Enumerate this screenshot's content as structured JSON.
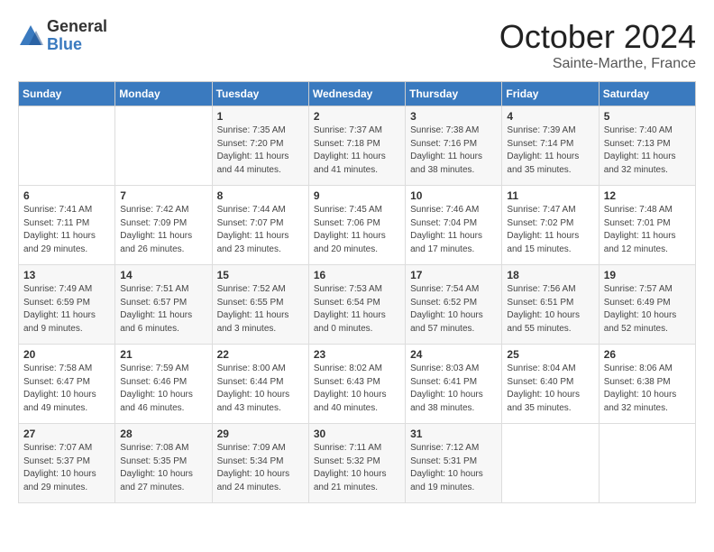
{
  "header": {
    "logo_general": "General",
    "logo_blue": "Blue",
    "month": "October 2024",
    "location": "Sainte-Marthe, France"
  },
  "weekdays": [
    "Sunday",
    "Monday",
    "Tuesday",
    "Wednesday",
    "Thursday",
    "Friday",
    "Saturday"
  ],
  "weeks": [
    [
      {
        "day": "",
        "info": ""
      },
      {
        "day": "",
        "info": ""
      },
      {
        "day": "1",
        "info": "Sunrise: 7:35 AM\nSunset: 7:20 PM\nDaylight: 11 hours\nand 44 minutes."
      },
      {
        "day": "2",
        "info": "Sunrise: 7:37 AM\nSunset: 7:18 PM\nDaylight: 11 hours\nand 41 minutes."
      },
      {
        "day": "3",
        "info": "Sunrise: 7:38 AM\nSunset: 7:16 PM\nDaylight: 11 hours\nand 38 minutes."
      },
      {
        "day": "4",
        "info": "Sunrise: 7:39 AM\nSunset: 7:14 PM\nDaylight: 11 hours\nand 35 minutes."
      },
      {
        "day": "5",
        "info": "Sunrise: 7:40 AM\nSunset: 7:13 PM\nDaylight: 11 hours\nand 32 minutes."
      }
    ],
    [
      {
        "day": "6",
        "info": "Sunrise: 7:41 AM\nSunset: 7:11 PM\nDaylight: 11 hours\nand 29 minutes."
      },
      {
        "day": "7",
        "info": "Sunrise: 7:42 AM\nSunset: 7:09 PM\nDaylight: 11 hours\nand 26 minutes."
      },
      {
        "day": "8",
        "info": "Sunrise: 7:44 AM\nSunset: 7:07 PM\nDaylight: 11 hours\nand 23 minutes."
      },
      {
        "day": "9",
        "info": "Sunrise: 7:45 AM\nSunset: 7:06 PM\nDaylight: 11 hours\nand 20 minutes."
      },
      {
        "day": "10",
        "info": "Sunrise: 7:46 AM\nSunset: 7:04 PM\nDaylight: 11 hours\nand 17 minutes."
      },
      {
        "day": "11",
        "info": "Sunrise: 7:47 AM\nSunset: 7:02 PM\nDaylight: 11 hours\nand 15 minutes."
      },
      {
        "day": "12",
        "info": "Sunrise: 7:48 AM\nSunset: 7:01 PM\nDaylight: 11 hours\nand 12 minutes."
      }
    ],
    [
      {
        "day": "13",
        "info": "Sunrise: 7:49 AM\nSunset: 6:59 PM\nDaylight: 11 hours\nand 9 minutes."
      },
      {
        "day": "14",
        "info": "Sunrise: 7:51 AM\nSunset: 6:57 PM\nDaylight: 11 hours\nand 6 minutes."
      },
      {
        "day": "15",
        "info": "Sunrise: 7:52 AM\nSunset: 6:55 PM\nDaylight: 11 hours\nand 3 minutes."
      },
      {
        "day": "16",
        "info": "Sunrise: 7:53 AM\nSunset: 6:54 PM\nDaylight: 11 hours\nand 0 minutes."
      },
      {
        "day": "17",
        "info": "Sunrise: 7:54 AM\nSunset: 6:52 PM\nDaylight: 10 hours\nand 57 minutes."
      },
      {
        "day": "18",
        "info": "Sunrise: 7:56 AM\nSunset: 6:51 PM\nDaylight: 10 hours\nand 55 minutes."
      },
      {
        "day": "19",
        "info": "Sunrise: 7:57 AM\nSunset: 6:49 PM\nDaylight: 10 hours\nand 52 minutes."
      }
    ],
    [
      {
        "day": "20",
        "info": "Sunrise: 7:58 AM\nSunset: 6:47 PM\nDaylight: 10 hours\nand 49 minutes."
      },
      {
        "day": "21",
        "info": "Sunrise: 7:59 AM\nSunset: 6:46 PM\nDaylight: 10 hours\nand 46 minutes."
      },
      {
        "day": "22",
        "info": "Sunrise: 8:00 AM\nSunset: 6:44 PM\nDaylight: 10 hours\nand 43 minutes."
      },
      {
        "day": "23",
        "info": "Sunrise: 8:02 AM\nSunset: 6:43 PM\nDaylight: 10 hours\nand 40 minutes."
      },
      {
        "day": "24",
        "info": "Sunrise: 8:03 AM\nSunset: 6:41 PM\nDaylight: 10 hours\nand 38 minutes."
      },
      {
        "day": "25",
        "info": "Sunrise: 8:04 AM\nSunset: 6:40 PM\nDaylight: 10 hours\nand 35 minutes."
      },
      {
        "day": "26",
        "info": "Sunrise: 8:06 AM\nSunset: 6:38 PM\nDaylight: 10 hours\nand 32 minutes."
      }
    ],
    [
      {
        "day": "27",
        "info": "Sunrise: 7:07 AM\nSunset: 5:37 PM\nDaylight: 10 hours\nand 29 minutes."
      },
      {
        "day": "28",
        "info": "Sunrise: 7:08 AM\nSunset: 5:35 PM\nDaylight: 10 hours\nand 27 minutes."
      },
      {
        "day": "29",
        "info": "Sunrise: 7:09 AM\nSunset: 5:34 PM\nDaylight: 10 hours\nand 24 minutes."
      },
      {
        "day": "30",
        "info": "Sunrise: 7:11 AM\nSunset: 5:32 PM\nDaylight: 10 hours\nand 21 minutes."
      },
      {
        "day": "31",
        "info": "Sunrise: 7:12 AM\nSunset: 5:31 PM\nDaylight: 10 hours\nand 19 minutes."
      },
      {
        "day": "",
        "info": ""
      },
      {
        "day": "",
        "info": ""
      }
    ]
  ]
}
